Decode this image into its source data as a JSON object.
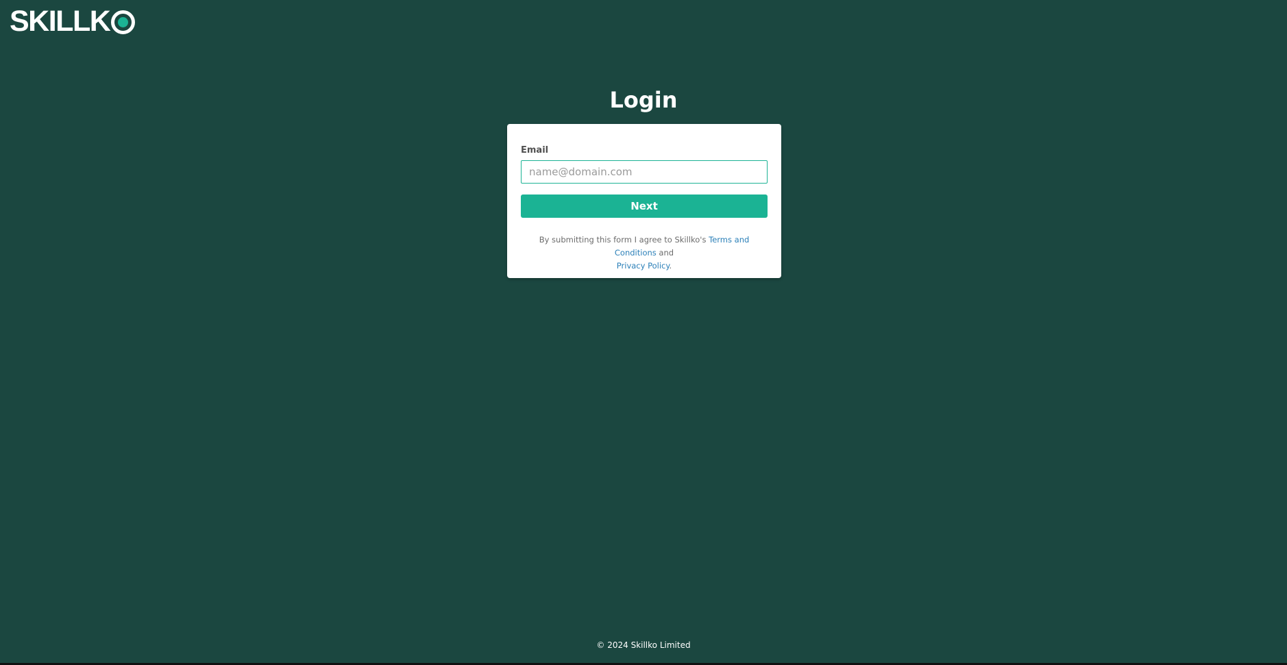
{
  "brand": {
    "logo_text": "SKILLK",
    "logo_o_icon": "ring-dot-o-icon",
    "colors": {
      "background": "#1b4740",
      "accent": "#1bb394",
      "link": "#2a7fb8"
    }
  },
  "login": {
    "title": "Login",
    "email_label": "Email",
    "email_value": "",
    "email_placeholder": "name@domain.com",
    "next_label": "Next",
    "terms_prefix": "By submitting this form I agree to Skillko's ",
    "terms_link": "Terms and Conditions",
    "terms_middle": " and ",
    "privacy_link": "Privacy Policy",
    "terms_suffix": "."
  },
  "footer": {
    "copyright": "© 2024 Skillko Limited"
  }
}
